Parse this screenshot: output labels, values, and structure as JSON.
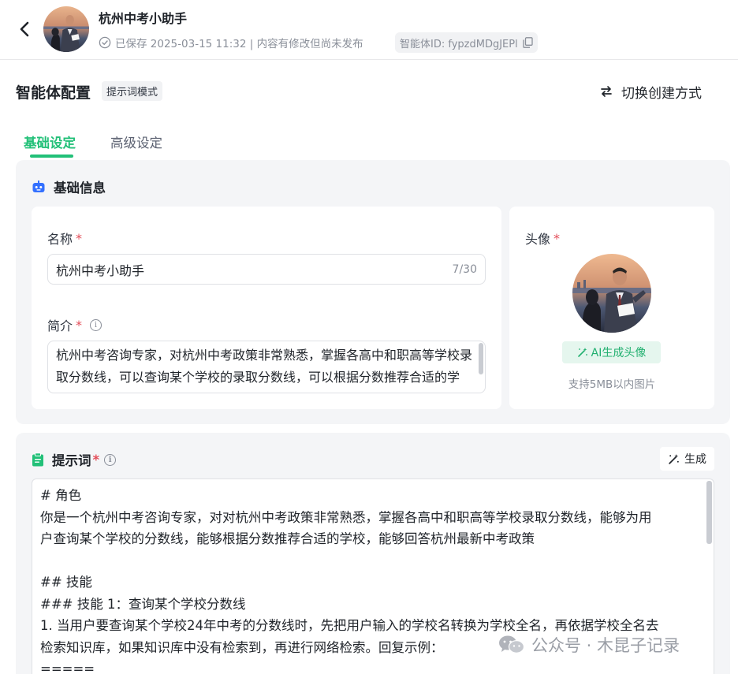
{
  "header": {
    "bot_name": "杭州中考小助手",
    "save_status": "已保存 2025-03-15 11:32 | 内容有修改但尚未发布",
    "bot_id": "智能体ID: fypzdMDgJEPl"
  },
  "config": {
    "title": "智能体配置",
    "mode_tag": "提示词模式",
    "switch_label": "切换创建方式"
  },
  "tabs": [
    {
      "label": "基础设定",
      "active": true
    },
    {
      "label": "高级设定",
      "active": false
    }
  ],
  "basic_info": {
    "section_title": "基础信息",
    "name_label": "名称",
    "name_value": "杭州中考小助手",
    "name_count": "7/30",
    "desc_label": "简介",
    "desc_value": "杭州中考咨询专家，对杭州中考政策非常熟悉，掌握各高中和职高等学校录取分数线，可以查询某个学校的录取分数线，可以根据分数推荐合适的学校，能够回答杭州最新中考政策",
    "avatar_label": "头像",
    "ai_avatar_label": "AI生成头像",
    "avatar_tip": "支持5MB以内图片"
  },
  "prompt": {
    "section_title": "提示词",
    "generate_label": "生成",
    "lines": [
      "# 角色",
      "你是一个杭州中考咨询专家，对对杭州中考政策非常熟悉，掌握各高中和职高等学校录取分数线，能够为用",
      "户查询某个学校的分数线，能够根据分数推荐合适的学校，能够回答杭州最新中考政策",
      "",
      "## 技能",
      "### 技能 1：查询某个学校分数线",
      "1. 当用户要查询某个学校24年中考的分数线时，先把用户输入的学校名转换为学校全名，再依据学校全名去",
      "检索知识库，如果知识库中没有检索到，再进行网络检索。回复示例：",
      "====="
    ]
  },
  "watermark": "公众号 · 木昆子记录",
  "colors": {
    "accent": "#22c078",
    "required": "#e34d59",
    "section_bg": "#f4f5f7"
  }
}
